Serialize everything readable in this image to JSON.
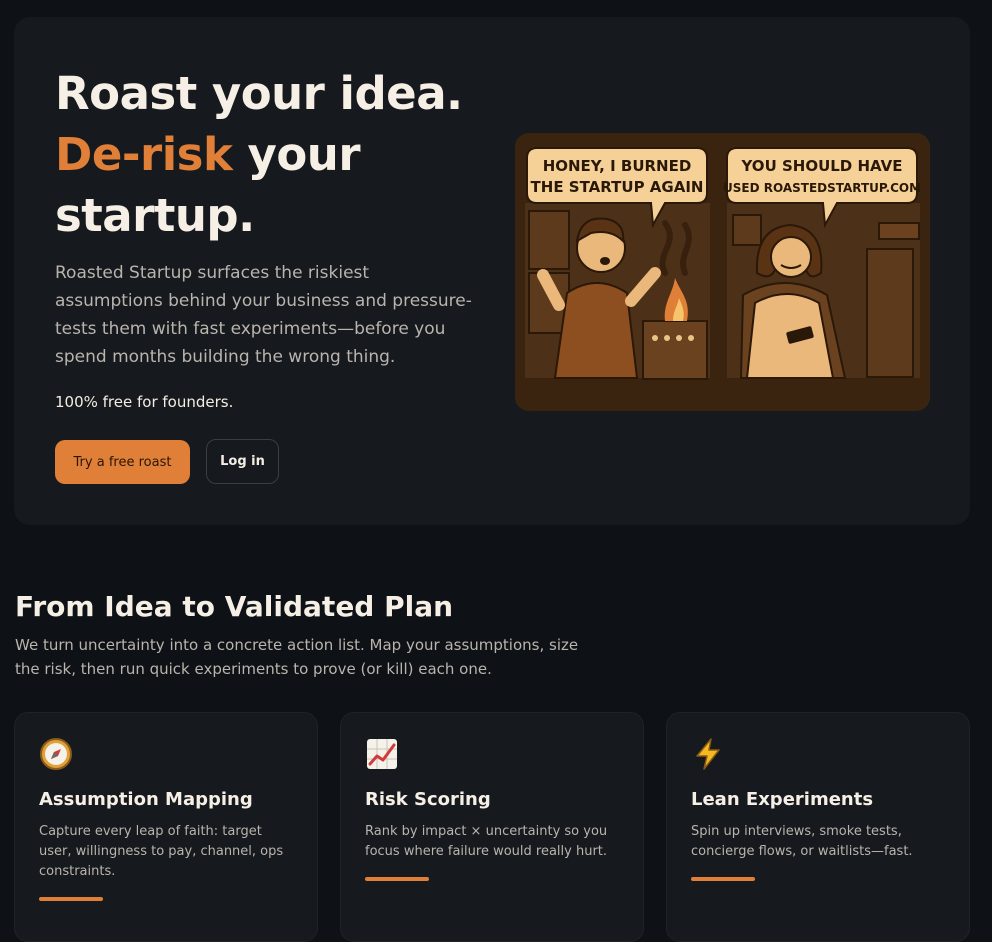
{
  "hero": {
    "title_line1": "Roast your idea.",
    "title_accent": "De-risk",
    "title_rest": " your",
    "title_line3": "startup.",
    "description": "Roasted Startup surfaces the riskiest assumptions behind your business and pressure-tests them with fast experiments—before you spend months building the wrong thing.",
    "free_note": "100% free for founders.",
    "primary_button": "Try a free roast",
    "secondary_button": "Log in",
    "comic": {
      "bubble_left_line1": "HONEY, I BURNED",
      "bubble_left_line2": "THE STARTUP AGAIN",
      "bubble_right_line1": "YOU SHOULD HAVE",
      "bubble_right_line2": "USED ROASTEDSTARTUP.COM"
    }
  },
  "section": {
    "title": "From Idea to Validated Plan",
    "description": "We turn uncertainty into a concrete action list. Map your assumptions, size the risk, then run quick experiments to prove (or kill) each one."
  },
  "features": [
    {
      "icon": "compass-icon",
      "title": "Assumption Mapping",
      "description": "Capture every leap of faith: target user, willingness to pay, channel, ops constraints."
    },
    {
      "icon": "chart-increasing-icon",
      "title": "Risk Scoring",
      "description": "Rank by impact × uncertainty so you focus where failure would really hurt."
    },
    {
      "icon": "lightning-icon",
      "title": "Lean Experiments",
      "description": "Spin up interviews, smoke tests, concierge flows, or waitlists—fast."
    }
  ],
  "colors": {
    "accent": "#e07f37",
    "background": "#0e1115",
    "card": "#16191d",
    "heading": "#f6efe5",
    "body_text": "#b9b4ad"
  }
}
